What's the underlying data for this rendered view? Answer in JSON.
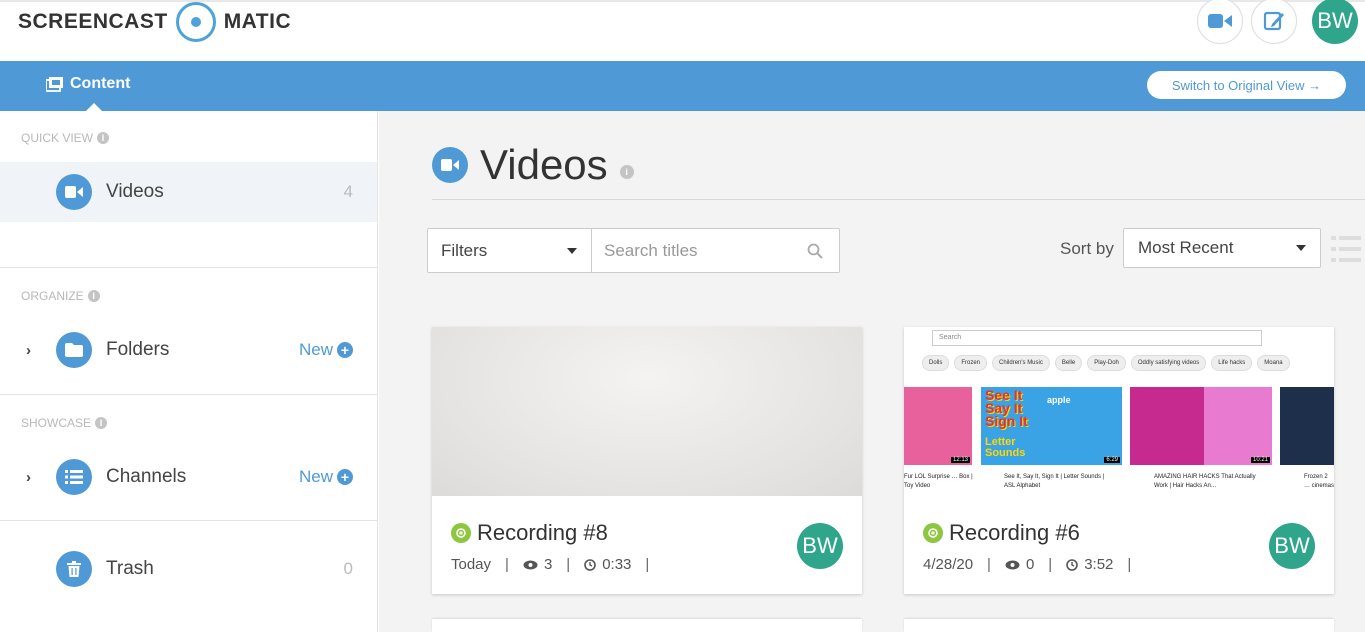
{
  "header": {
    "logo_left": "SCREENCAST",
    "logo_right": "MATIC",
    "avatar": "BW",
    "icons": [
      "video-camera-icon",
      "edit-icon"
    ]
  },
  "navbar": {
    "tab_label": "Content",
    "switch_label": "Switch to Original View →"
  },
  "sidebar": {
    "quick_view_label": "QUICK VIEW",
    "organize_label": "ORGANIZE",
    "showcase_label": "SHOWCASE",
    "videos": {
      "label": "Videos",
      "count": "4"
    },
    "folders": {
      "label": "Folders",
      "new_label": "New"
    },
    "channels": {
      "label": "Channels",
      "new_label": "New"
    },
    "trash": {
      "label": "Trash",
      "count": "0"
    }
  },
  "main": {
    "title": "Videos",
    "filters_label": "Filters",
    "search_placeholder": "Search titles",
    "sort_label": "Sort by",
    "sort_value": "Most Recent"
  },
  "cards": [
    {
      "title": "Recording #8",
      "date": "Today",
      "views": "3",
      "duration": "0:33",
      "avatar": "BW"
    },
    {
      "title": "Recording #6",
      "date": "4/28/20",
      "views": "0",
      "duration": "3:52",
      "avatar": "BW"
    }
  ],
  "thumbnail_youtube": {
    "search_text": "Search",
    "chips": [
      "Dolls",
      "Frozen",
      "Children's Music",
      "Belle",
      "Play-Doh",
      "Oddly satisfying videos",
      "Life hacks",
      "Moana"
    ],
    "tile_big_text": [
      "See It",
      "Say It",
      "Sign It"
    ],
    "tile_letter_text": "Letter Sounds",
    "tile_apple_word": "apple",
    "durations": [
      "12:13",
      "6:29",
      "10:21"
    ],
    "captions": [
      "Fur LOL Surprise … Box | Toy Video",
      "See It, Say It, Sign It | Letter Sounds | ASL Alphabet",
      "AMAZING HAIR HACKS That Actually Work | Hair Hacks An…",
      "Frozen 2 … cinemas"
    ],
    "colors": {
      "pink": "#e8609c",
      "blue": "#2b78c4",
      "green": "#9fd13a",
      "yellow": "#f3d21e"
    }
  },
  "colors": {
    "accent": "#4f9ad6",
    "avatar": "#2fa58b",
    "status_green": "#8dc63f"
  }
}
